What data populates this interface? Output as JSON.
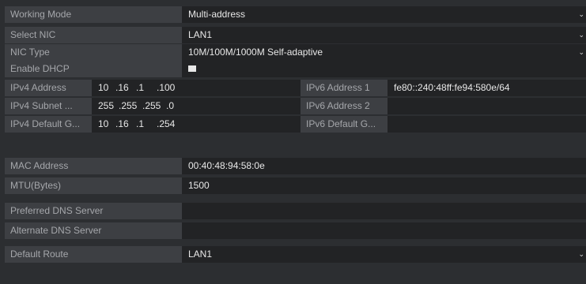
{
  "working_mode": {
    "label": "Working Mode",
    "value": "Multi-address"
  },
  "select_nic": {
    "label": "Select NIC",
    "value": "LAN1"
  },
  "nic_type": {
    "label": "NIC Type",
    "value": "10M/100M/1000M Self-adaptive"
  },
  "enable_dhcp": {
    "label": "Enable DHCP",
    "checked": false
  },
  "ipv4_address": {
    "label": "IPv4 Address",
    "octets": [
      "10",
      ".16",
      ".1",
      ".100"
    ]
  },
  "ipv4_subnet": {
    "label": "IPv4 Subnet ...",
    "octets": [
      "255",
      ".255",
      ".255",
      ".0"
    ]
  },
  "ipv4_gateway": {
    "label": "IPv4 Default G...",
    "octets": [
      "10",
      ".16",
      ".1",
      ".254"
    ]
  },
  "ipv6_address_1": {
    "label": "IPv6 Address 1",
    "value": "fe80::240:48ff:fe94:580e/64"
  },
  "ipv6_address_2": {
    "label": "IPv6 Address 2",
    "value": ""
  },
  "ipv6_gateway": {
    "label": "IPv6 Default G...",
    "value": ""
  },
  "mac_address": {
    "label": "MAC Address",
    "value": "00:40:48:94:58:0e"
  },
  "mtu": {
    "label": "MTU(Bytes)",
    "value": "1500"
  },
  "preferred_dns": {
    "label": "Preferred DNS Server",
    "value": ""
  },
  "alternate_dns": {
    "label": "Alternate DNS Server",
    "value": ""
  },
  "default_route": {
    "label": "Default Route",
    "value": "LAN1"
  },
  "icons": {
    "dropdown": "chevron-down-icon"
  }
}
